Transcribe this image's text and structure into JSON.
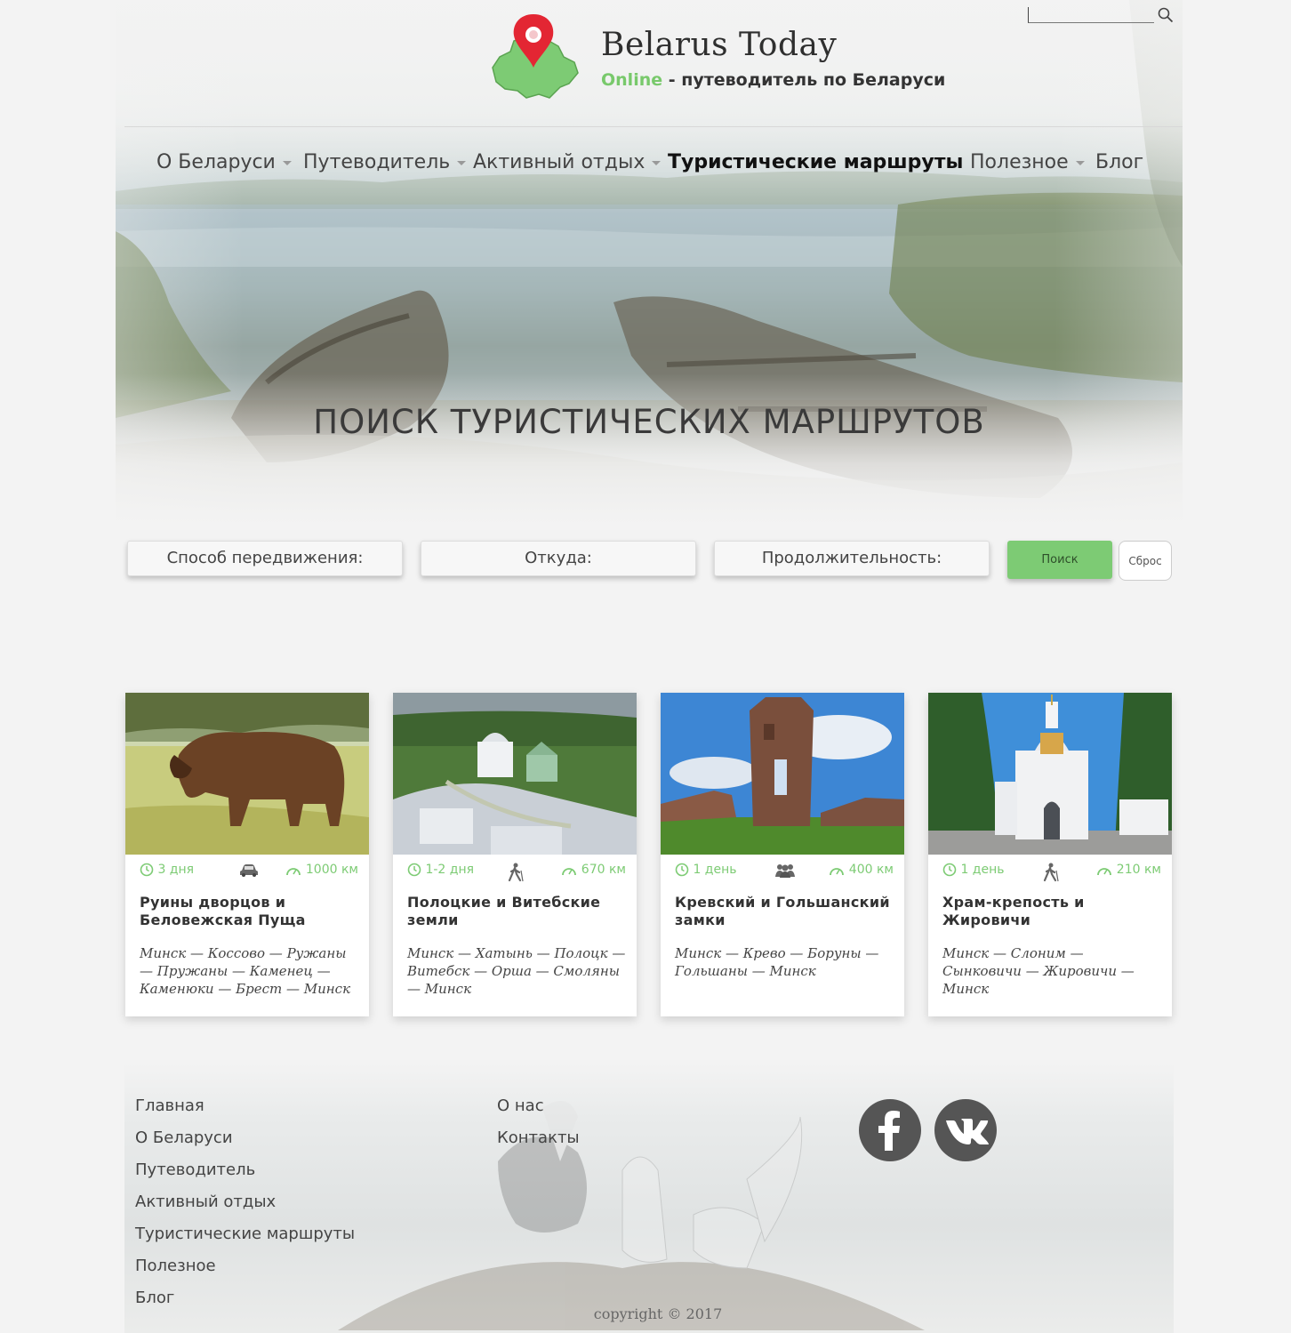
{
  "site": {
    "title": "Belarus Today",
    "tagline_highlight": "Online",
    "tagline_rest": " - путеводитель по Беларуси"
  },
  "search": {
    "placeholder": "",
    "value": ""
  },
  "nav": [
    {
      "label": "О Беларуси",
      "dropdown": true,
      "active": false
    },
    {
      "label": "Путеводитель",
      "dropdown": true,
      "active": false
    },
    {
      "label": "Активный отдых",
      "dropdown": true,
      "active": false
    },
    {
      "label": "Туристические маршруты",
      "dropdown": false,
      "active": true
    },
    {
      "label": "Полезное",
      "dropdown": true,
      "active": false
    },
    {
      "label": "Блог",
      "dropdown": false,
      "active": false
    }
  ],
  "hero": {
    "title": "ПОИСК ТУРИСТИЧЕСКИХ МАРШРУТОВ"
  },
  "filters": {
    "transport_label": "Способ передвижения:",
    "from_label": "Откуда:",
    "duration_label": "Продолжительность:",
    "search_button": "Поиск",
    "reset_button": "Сброс"
  },
  "routes": [
    {
      "duration": "3 дня",
      "transport_icon": "car-icon",
      "distance": "1000 км",
      "title": "Руины дворцов и Беловежская Пуща",
      "route": "Минск — Коссово — Ружаны — Пружаны — Каменец — Каменюки — Брест — Минск"
    },
    {
      "duration": "1-2 дня",
      "transport_icon": "walking-icon",
      "distance": "670 км",
      "title": "Полоцкие и Витебские земли",
      "route": "Минск — Хатынь — Полоцк — Витебск — Орша — Смоляны — Минск"
    },
    {
      "duration": "1 день",
      "transport_icon": "group-icon",
      "distance": "400 км",
      "title": "Кревский и Гольшанский замки",
      "route": "Минск — Крево — Боруны — Гольшаны — Минск"
    },
    {
      "duration": "1 день",
      "transport_icon": "walking-icon",
      "distance": "210 км",
      "title": "Храм-крепость и Жировичи",
      "route": "Минск — Слоним — Сынковичи — Жировичи — Минск"
    }
  ],
  "footer": {
    "col1": [
      "Главная",
      "О Беларуси",
      "Путеводитель",
      "Активный отдых",
      "Туристические маршруты",
      "Полезное",
      "Блог"
    ],
    "col2": [
      "О нас",
      "Контакты"
    ],
    "social": [
      "facebook-icon",
      "vk-icon"
    ],
    "copyright": "copyright © 2017"
  },
  "colors": {
    "accent": "#7dcb74",
    "text": "#333333",
    "background": "#f3f3f3"
  }
}
